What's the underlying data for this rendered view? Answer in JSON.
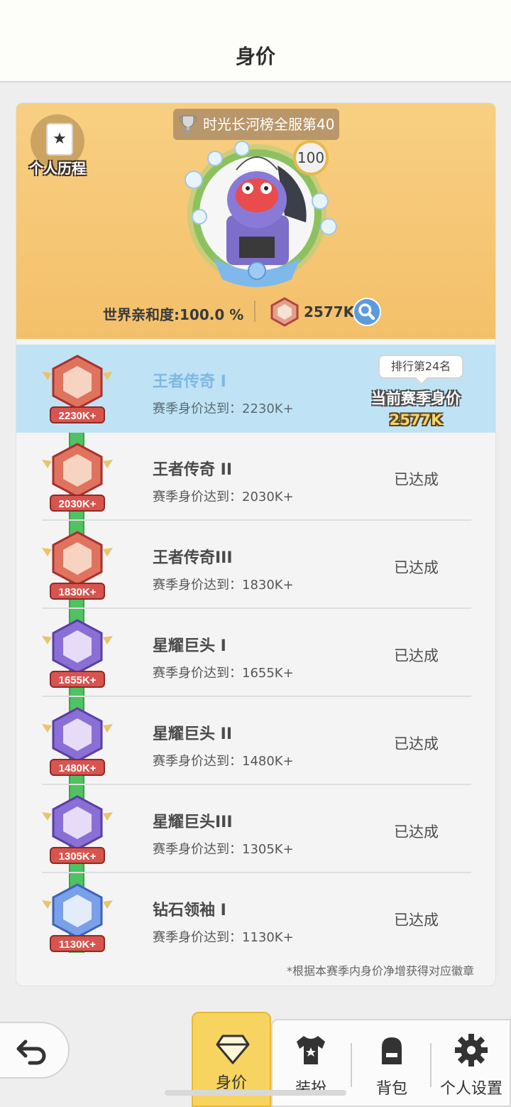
{
  "header": {
    "title": "身价"
  },
  "profile": {
    "history_label": "个人历程",
    "rank_banner": "时光长河榜全服第40",
    "level": "100",
    "affinity": "世界亲和度:100.0 %",
    "worth_value": "2577K"
  },
  "current": {
    "rank_tip": "排行第24名",
    "label": "当前赛季身价",
    "value": "2577K"
  },
  "tiers": [
    {
      "name": "王者传奇 I",
      "requirement": "赛季身价达到：2230K+",
      "badge": "2230K+",
      "status": "",
      "current": true,
      "color": "red"
    },
    {
      "name": "王者传奇 II",
      "requirement": "赛季身价达到：2030K+",
      "badge": "2030K+",
      "status": "已达成",
      "current": false,
      "color": "red"
    },
    {
      "name": "王者传奇III",
      "requirement": "赛季身价达到：1830K+",
      "badge": "1830K+",
      "status": "已达成",
      "current": false,
      "color": "red"
    },
    {
      "name": "星耀巨头 I",
      "requirement": "赛季身价达到：1655K+",
      "badge": "1655K+",
      "status": "已达成",
      "current": false,
      "color": "purple"
    },
    {
      "name": "星耀巨头 II",
      "requirement": "赛季身价达到：1480K+",
      "badge": "1480K+",
      "status": "已达成",
      "current": false,
      "color": "purple"
    },
    {
      "name": "星耀巨头III",
      "requirement": "赛季身价达到：1305K+",
      "badge": "1305K+",
      "status": "已达成",
      "current": false,
      "color": "purple"
    },
    {
      "name": "钻石领袖 I",
      "requirement": "赛季身价达到：1130K+",
      "badge": "1130K+",
      "status": "已达成",
      "current": false,
      "color": "blue"
    }
  ],
  "footnote": "*根据本赛季内身价净增获得对应徽章",
  "nav": {
    "tabs": [
      {
        "label": "身价",
        "icon": "diamond-icon",
        "active": true
      },
      {
        "label": "装扮",
        "icon": "shirt-icon",
        "active": false
      },
      {
        "label": "背包",
        "icon": "backpack-icon",
        "active": false
      },
      {
        "label": "个人设置",
        "icon": "gear-icon",
        "active": false
      }
    ]
  },
  "colors": {
    "accent_yellow": "#f6d45f",
    "profile_bg": "#f3c06a",
    "current_row_bg": "#bfe3f5",
    "track_green": "#4fc262"
  }
}
